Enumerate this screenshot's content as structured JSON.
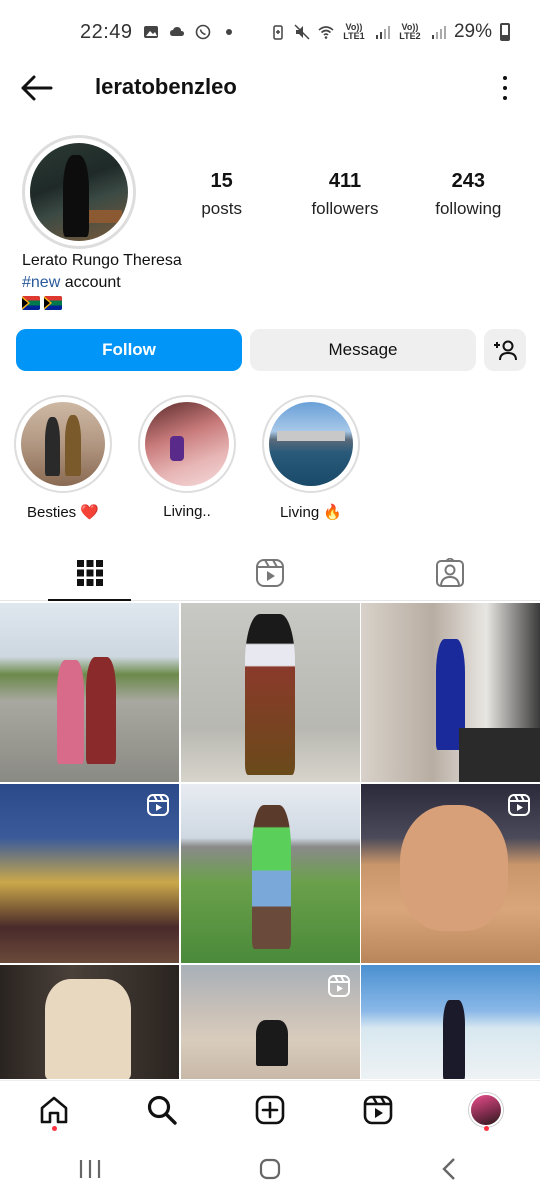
{
  "status_bar": {
    "time": "22:49",
    "lte1": "Vo)) LTE1",
    "lte2": "Vo)) LTE2",
    "battery": "29%"
  },
  "header": {
    "username": "leratobenzleo"
  },
  "profile": {
    "posts_count": "15",
    "posts_label": "posts",
    "followers_count": "411",
    "followers_label": "followers",
    "following_count": "243",
    "following_label": "following",
    "full_name": "Lerato Rungo Theresa",
    "bio_hashtag": "#new",
    "bio_rest": " account",
    "flags": [
      "south-africa-flag",
      "south-africa-flag"
    ]
  },
  "actions": {
    "follow_label": "Follow",
    "message_label": "Message"
  },
  "highlights": [
    {
      "label": "Besties ❤️"
    },
    {
      "label": "Living.."
    },
    {
      "label": "Living 🔥"
    }
  ],
  "tabs": [
    "grid-icon",
    "reels-icon",
    "tagged-icon"
  ],
  "posts": [
    {
      "type": "photo"
    },
    {
      "type": "photo"
    },
    {
      "type": "photo"
    },
    {
      "type": "reel"
    },
    {
      "type": "photo"
    },
    {
      "type": "reel"
    },
    {
      "type": "photo"
    },
    {
      "type": "reel"
    },
    {
      "type": "photo"
    }
  ],
  "bottom_nav": [
    "home-icon",
    "search-icon",
    "create-icon",
    "reels-icon",
    "profile-avatar"
  ],
  "colors": {
    "follow_button": "#0095f6",
    "secondary_button": "#efefef",
    "hashtag": "#2a5a9a",
    "notification_dot": "#ff3040"
  }
}
